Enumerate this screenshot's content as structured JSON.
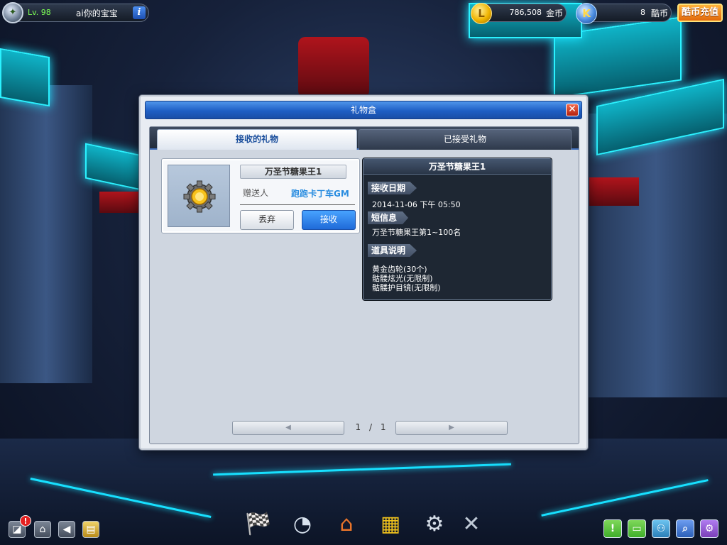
{
  "player": {
    "level": "Lv. 98",
    "name": "ai你的宝宝",
    "info_icon": "i"
  },
  "currency": {
    "gold_amount": "786,508",
    "gold_unit": "金币",
    "gold_icon": "L",
    "kcoin_amount": "8",
    "kcoin_unit": "酷币",
    "kcoin_icon": "K",
    "recharge_label": "酷币充值"
  },
  "dialog": {
    "title": "礼物盒",
    "close_label": "✕",
    "tabs": [
      {
        "label": "接收的礼物",
        "active": true
      },
      {
        "label": "已接受礼物",
        "active": false
      }
    ],
    "gift": {
      "item_name": "万圣节糖果王1",
      "sender_label": "赠送人",
      "sender_name": "跑跑卡丁车GM",
      "discard_label": "丢弃",
      "accept_label": "接收"
    },
    "detail": {
      "title": "万圣节糖果王1",
      "date_heading": "接收日期",
      "date_value": "2014-11-06 下午 05:50",
      "message_heading": "短信息",
      "message_value": "万圣节糖果王第1~100名",
      "desc_heading": "道具说明",
      "desc_lines": [
        "黄金齿轮(30个)",
        "骷髅炫光(无限制)",
        "骷髅护目镜(无限制)"
      ]
    },
    "pager": {
      "prev": "◀",
      "next": "▶",
      "current": "1",
      "separator": "/",
      "total": "1"
    }
  },
  "bottom_left": {
    "alert_badge": "!",
    "buttons": [
      {
        "icon": "map-icon",
        "glyph": "◪"
      },
      {
        "icon": "home-icon",
        "glyph": "⌂"
      },
      {
        "icon": "back-icon",
        "glyph": "◀"
      },
      {
        "icon": "notes-icon",
        "glyph": "▤"
      }
    ]
  },
  "dock": [
    {
      "icon": "race-kart-icon",
      "glyph": "🏁"
    },
    {
      "icon": "speedometer-icon",
      "glyph": "◔"
    },
    {
      "icon": "garage-icon",
      "glyph": "⌂"
    },
    {
      "icon": "shop-icon",
      "glyph": "▦"
    },
    {
      "icon": "tuning-gear-icon",
      "glyph": "⚙"
    },
    {
      "icon": "tools-icon",
      "glyph": "✕"
    }
  ],
  "bottom_right": [
    {
      "icon": "quest-icon",
      "glyph": "!",
      "color": "#3fae2a"
    },
    {
      "icon": "chat-icon",
      "glyph": "▭",
      "color": "#3fae2a"
    },
    {
      "icon": "friends-icon",
      "glyph": "⚇",
      "color": "#2a7fb8"
    },
    {
      "icon": "search-icon",
      "glyph": "⌕",
      "color": "#2a5fb8"
    },
    {
      "icon": "settings-icon",
      "glyph": "⚙",
      "color": "#7a3fb8"
    }
  ]
}
